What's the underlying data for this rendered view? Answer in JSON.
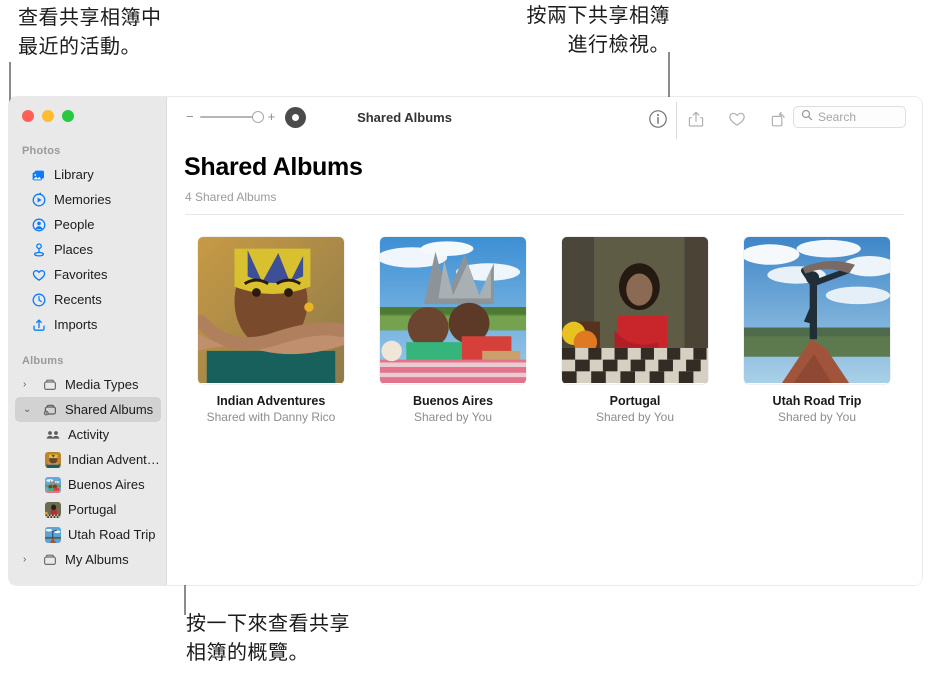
{
  "annotations": [
    {
      "id": "top-left",
      "text": "查看共享相簿中\n最近的活動。"
    },
    {
      "id": "top-middle",
      "text": "按兩下共享相簿\n進行檢視。"
    },
    {
      "id": "bottom-left",
      "text": "按一下來查看共享\n相簿的概覽。"
    }
  ],
  "window": {
    "traffic_lights": [
      "close",
      "minimize",
      "zoom"
    ],
    "colors": {
      "close": "#ff5f57",
      "minimize": "#febc2e",
      "zoom": "#28c840",
      "accent": "#0a7cff",
      "sidebar_bg": "#e9e9e9",
      "selected_row": "#d2d2d2"
    }
  },
  "sidebar": {
    "sections": [
      {
        "title": "Photos",
        "items": [
          {
            "label": "Library",
            "icon": "library-icon"
          },
          {
            "label": "Memories",
            "icon": "memories-icon"
          },
          {
            "label": "People",
            "icon": "people-icon"
          },
          {
            "label": "Places",
            "icon": "places-icon"
          },
          {
            "label": "Favorites",
            "icon": "heart-icon"
          },
          {
            "label": "Recents",
            "icon": "clock-icon"
          },
          {
            "label": "Imports",
            "icon": "import-icon"
          }
        ]
      },
      {
        "title": "Albums",
        "items": [
          {
            "label": "Media Types",
            "icon": "album-icon",
            "twisty": "›",
            "expanded": false,
            "selected": false
          },
          {
            "label": "Shared Albums",
            "icon": "shared-album-icon",
            "twisty": "⌄",
            "expanded": true,
            "selected": true
          },
          {
            "label": "Activity",
            "icon": "activity-icon",
            "child": true
          },
          {
            "label": "Indian Advent…",
            "icon": "thumb-indian",
            "child": true
          },
          {
            "label": "Buenos Aires",
            "icon": "thumb-buenos",
            "child": true
          },
          {
            "label": "Portugal",
            "icon": "thumb-portugal",
            "child": true
          },
          {
            "label": "Utah Road Trip",
            "icon": "thumb-utah",
            "child": true
          },
          {
            "label": "My Albums",
            "icon": "album-icon",
            "twisty": "›",
            "expanded": false,
            "selected": false
          }
        ]
      }
    ]
  },
  "toolbar": {
    "zoom_minus": "−",
    "zoom_plus": "+",
    "live_button": "live-photo-icon",
    "title": "Shared Albums",
    "info_icon": "info-icon",
    "share_icon": "share-icon",
    "favorite_icon": "heart-icon",
    "rotate_icon": "rotate-icon",
    "search_icon": "search-icon",
    "search_placeholder": "Search",
    "search_value": ""
  },
  "main": {
    "title": "Shared Albums",
    "subtitle": "4 Shared Albums",
    "albums": [
      {
        "name": "Indian Adventures",
        "shared": "Shared with Danny Rico",
        "thumb": "thumb-indian"
      },
      {
        "name": "Buenos Aires",
        "shared": "Shared by You",
        "thumb": "thumb-buenos"
      },
      {
        "name": "Portugal",
        "shared": "Shared by You",
        "thumb": "thumb-portugal"
      },
      {
        "name": "Utah Road Trip",
        "shared": "Shared by You",
        "thumb": "thumb-utah"
      }
    ]
  }
}
